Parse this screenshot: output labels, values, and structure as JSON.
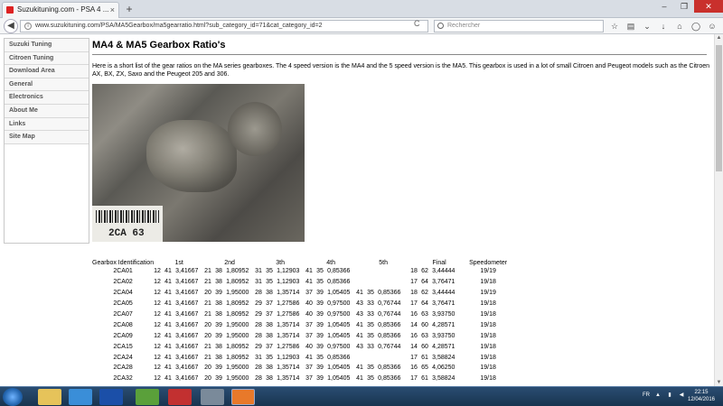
{
  "browser": {
    "tab_title": "Suzukituning.com - PSA 4 ...",
    "tab_close": "×",
    "new_tab": "+",
    "window_buttons": [
      "–",
      "❐",
      "✕"
    ],
    "url": "www.suzukituning.com/PSA/MA5Gearbox/ma5gearratio.html?sub_category_id=71&cat_category_id=2",
    "reload": "C",
    "search_placeholder": "Rechercher"
  },
  "sidebar": {
    "items": [
      {
        "label": "Suzuki Tuning"
      },
      {
        "label": "Citroen Tuning"
      },
      {
        "label": "Download Area"
      },
      {
        "label": "General"
      },
      {
        "label": "Electronics"
      },
      {
        "label": "About Me"
      },
      {
        "label": "Links"
      },
      {
        "label": "Site Map"
      }
    ]
  },
  "page": {
    "title": "MA4 & MA5 Gearbox Ratio's",
    "intro": "Here is a short list of the gear ratios on the MA series gearboxes. The 4 speed version is the MA4 and the 5 speed version is the MA5. This gearbox is used in a lot of small Citroen and Peugeot models such as the Citroen AX, BX, ZX, Saxo and the Peugeot 205 and 306.",
    "photo_code": "2CA 63"
  },
  "table": {
    "headers": [
      "Gearbox Identification",
      "1st",
      "2nd",
      "3th",
      "4th",
      "5th",
      "Final",
      "Speedometer"
    ],
    "rows": [
      [
        "2CA01",
        "12",
        "41",
        "3,41667",
        "21",
        "38",
        "1,80952",
        "31",
        "35",
        "1,12903",
        "41",
        "35",
        "0,85366",
        "",
        "",
        "",
        "18",
        "62",
        "3,44444",
        "19/19"
      ],
      [
        "2CA02",
        "12",
        "41",
        "3,41667",
        "21",
        "38",
        "1,80952",
        "31",
        "35",
        "1,12903",
        "41",
        "35",
        "0,85366",
        "",
        "",
        "",
        "17",
        "64",
        "3,76471",
        "19/18"
      ],
      [
        "2CA04",
        "12",
        "41",
        "3,41667",
        "20",
        "39",
        "1,95000",
        "28",
        "38",
        "1,35714",
        "37",
        "39",
        "1,05405",
        "41",
        "35",
        "0,85366",
        "18",
        "62",
        "3,44444",
        "19/19"
      ],
      [
        "2CA05",
        "12",
        "41",
        "3,41667",
        "21",
        "38",
        "1,80952",
        "29",
        "37",
        "1,27586",
        "40",
        "39",
        "0,97500",
        "43",
        "33",
        "0,76744",
        "17",
        "64",
        "3,76471",
        "19/18"
      ],
      [
        "2CA07",
        "12",
        "41",
        "3,41667",
        "21",
        "38",
        "1,80952",
        "29",
        "37",
        "1,27586",
        "40",
        "39",
        "0,97500",
        "43",
        "33",
        "0,76744",
        "16",
        "63",
        "3,93750",
        "19/18"
      ],
      [
        "2CA08",
        "12",
        "41",
        "3,41667",
        "20",
        "39",
        "1,95000",
        "28",
        "38",
        "1,35714",
        "37",
        "39",
        "1,05405",
        "41",
        "35",
        "0,85366",
        "14",
        "60",
        "4,28571",
        "19/18"
      ],
      [
        "2CA09",
        "12",
        "41",
        "3,41667",
        "20",
        "39",
        "1,95000",
        "28",
        "38",
        "1,35714",
        "37",
        "39",
        "1,05405",
        "41",
        "35",
        "0,85366",
        "16",
        "63",
        "3,93750",
        "19/18"
      ],
      [
        "2CA15",
        "12",
        "41",
        "3,41667",
        "21",
        "38",
        "1,80952",
        "29",
        "37",
        "1,27586",
        "40",
        "39",
        "0,97500",
        "43",
        "33",
        "0,76744",
        "14",
        "60",
        "4,28571",
        "19/18"
      ],
      [
        "2CA24",
        "12",
        "41",
        "3,41667",
        "21",
        "38",
        "1,80952",
        "31",
        "35",
        "1,12903",
        "41",
        "35",
        "0,85366",
        "",
        "",
        "",
        "17",
        "61",
        "3,58824",
        "19/18"
      ],
      [
        "2CA28",
        "12",
        "41",
        "3,41667",
        "20",
        "39",
        "1,95000",
        "28",
        "38",
        "1,35714",
        "37",
        "39",
        "1,05405",
        "41",
        "35",
        "0,85366",
        "16",
        "65",
        "4,06250",
        "19/18"
      ],
      [
        "2CA32",
        "12",
        "41",
        "3,41667",
        "20",
        "39",
        "1,95000",
        "28",
        "38",
        "1,35714",
        "37",
        "39",
        "1,05405",
        "41",
        "35",
        "0,85366",
        "17",
        "61",
        "3,58824",
        "19/18"
      ]
    ]
  },
  "taskbar": {
    "tray_lang": "FR",
    "time": "22:15",
    "date": "12/04/2016"
  },
  "colors": {
    "accent": "#d22222",
    "taskbar": "#18344f"
  }
}
